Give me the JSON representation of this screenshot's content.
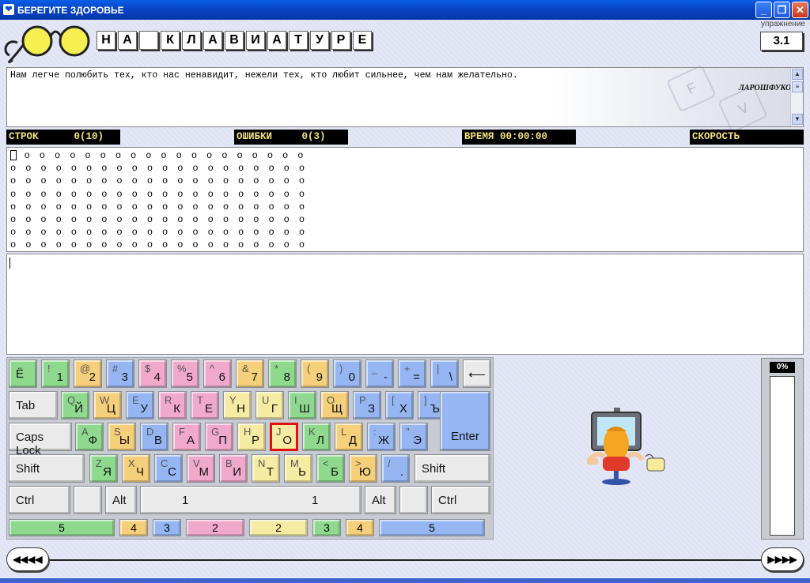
{
  "window": {
    "title": "БЕРЕГИТЕ ЗДОРОВЬЕ",
    "min": "_",
    "max": "❐",
    "close": "✕"
  },
  "header": {
    "title_letters": [
      "Н",
      "А",
      "",
      "К",
      "Л",
      "А",
      "В",
      "И",
      "А",
      "Т",
      "У",
      "Р",
      "Е"
    ],
    "exercise_label": "упражнение",
    "exercise_number": "3.1"
  },
  "sample": {
    "text": "Нам легче полюбить тех, кто нас ненавидит, нежели тех, кто любит сильнее, чем нам желательно.",
    "author": "ЛАРОШФУКО",
    "deco_letters": [
      "F",
      "V"
    ]
  },
  "stats": {
    "lines": "СТРОК      0(10)",
    "errors": "ОШИБКИ     0(3)",
    "time": "ВРЕМЯ 00:00:00",
    "speed": "СКОРОСТЬ"
  },
  "pattern": {
    "cursor_char": "о",
    "rows": [
      "о о о о о о о о о о о о о о о о о о о",
      "о о о о о о о о о о о о о о о о о о о о",
      "о о о о о о о о о о о о о о о о о о о о",
      "о о о о о о о о о о о о о о о о о о о о",
      "о о о о о о о о о о о о о о о о о о о о",
      "о о о о о о о о о о о о о о о о о о о о",
      "о о о о о о о о о о о о о о о о о о о о",
      "о о о о о о о о о о о о о о о о о о о о"
    ]
  },
  "keyboard": {
    "row1": [
      {
        "main": "Ё",
        "color": "g"
      },
      {
        "shift": "!",
        "main": "1",
        "color": "g"
      },
      {
        "shift": "@",
        "main": "2",
        "color": "o"
      },
      {
        "shift": "#",
        "main": "3",
        "color": "b"
      },
      {
        "shift": "$",
        "main": "4",
        "color": "p"
      },
      {
        "shift": "%",
        "main": "5",
        "color": "p"
      },
      {
        "shift": "^",
        "main": "6",
        "color": "p"
      },
      {
        "shift": "&",
        "main": "7",
        "color": "o"
      },
      {
        "shift": "*",
        "main": "8",
        "color": "g"
      },
      {
        "shift": "(",
        "main": "9",
        "color": "o"
      },
      {
        "shift": ")",
        "main": "0",
        "color": "b"
      },
      {
        "shift": "_",
        "main": "-",
        "color": "b"
      },
      {
        "shift": "+",
        "main": "=",
        "color": "b"
      },
      {
        "shift": "|",
        "main": "\\",
        "color": "b"
      }
    ],
    "backspace": "⟵",
    "row2": [
      {
        "shift": "Q",
        "main": "Й",
        "color": "g"
      },
      {
        "shift": "W",
        "main": "Ц",
        "color": "o"
      },
      {
        "shift": "E",
        "main": "У",
        "color": "b"
      },
      {
        "shift": "R",
        "main": "К",
        "color": "p"
      },
      {
        "shift": "T",
        "main": "Е",
        "color": "p"
      },
      {
        "shift": "Y",
        "main": "Н",
        "color": "y"
      },
      {
        "shift": "U",
        "main": "Г",
        "color": "y"
      },
      {
        "shift": "I",
        "main": "Ш",
        "color": "g"
      },
      {
        "shift": "O",
        "main": "Щ",
        "color": "o"
      },
      {
        "shift": "P",
        "main": "З",
        "color": "b"
      },
      {
        "shift": "[",
        "main": "Х",
        "color": "b"
      },
      {
        "shift": "]",
        "main": "Ъ",
        "color": "b"
      }
    ],
    "tab": "Tab",
    "row3": [
      {
        "shift": "A",
        "main": "Ф",
        "color": "g"
      },
      {
        "shift": "S",
        "main": "Ы",
        "color": "o"
      },
      {
        "shift": "D",
        "main": "В",
        "color": "b"
      },
      {
        "shift": "F",
        "main": "А",
        "color": "p"
      },
      {
        "shift": "G",
        "main": "П",
        "color": "p"
      },
      {
        "shift": "H",
        "main": "Р",
        "color": "y"
      },
      {
        "shift": "J",
        "main": "О",
        "color": "y",
        "selected": true
      },
      {
        "shift": "K",
        "main": "Л",
        "color": "g"
      },
      {
        "shift": "L",
        "main": "Д",
        "color": "o"
      },
      {
        "shift": ":",
        "main": "Ж",
        "color": "b"
      },
      {
        "shift": "\"",
        "main": "Э",
        "color": "b"
      }
    ],
    "caps": "Caps  Lock",
    "enter": "Enter",
    "row4": [
      {
        "shift": "Z",
        "main": "Я",
        "color": "g"
      },
      {
        "shift": "X",
        "main": "Ч",
        "color": "o"
      },
      {
        "shift": "C",
        "main": "С",
        "color": "b"
      },
      {
        "shift": "V",
        "main": "М",
        "color": "p"
      },
      {
        "shift": "B",
        "main": "И",
        "color": "p"
      },
      {
        "shift": "N",
        "main": "Т",
        "color": "y"
      },
      {
        "shift": "M",
        "main": "Ь",
        "color": "y"
      },
      {
        "shift": "<",
        "main": "Б",
        "color": "g"
      },
      {
        "shift": ">",
        "main": "Ю",
        "color": "o"
      },
      {
        "shift": "/",
        "main": ".",
        "color": "b"
      }
    ],
    "shift_left": "Shift",
    "shift_right": "Shift",
    "ctrl_left": "Ctrl",
    "alt_left": "Alt",
    "space_left": "1",
    "space_right": "1",
    "alt_right": "Alt",
    "ctrl_right": "Ctrl",
    "finger_bar": [
      {
        "label": "5",
        "color": "g"
      },
      {
        "label": "4",
        "color": "o"
      },
      {
        "label": "3",
        "color": "b"
      },
      {
        "label": "2",
        "color": "p"
      },
      {
        "label": "2",
        "color": "y"
      },
      {
        "label": "3",
        "color": "g"
      },
      {
        "label": "4",
        "color": "o"
      },
      {
        "label": "5",
        "color": "b"
      }
    ]
  },
  "progress": {
    "label": "0%",
    "value": 0
  },
  "nav": {
    "prev": "◀◀◀◀",
    "next": "▶▶▶▶"
  }
}
